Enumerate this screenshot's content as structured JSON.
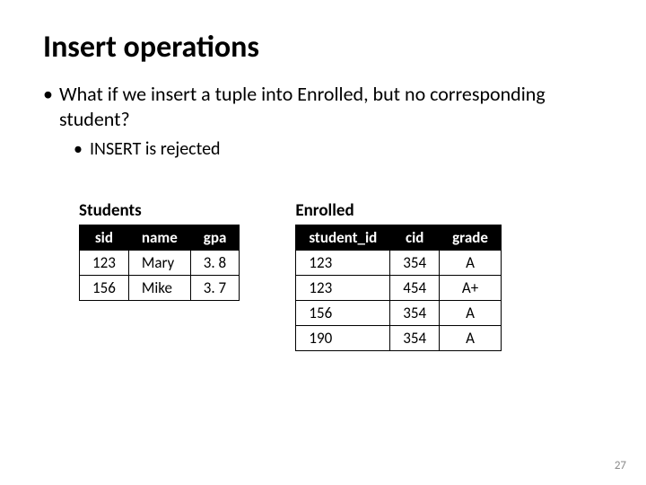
{
  "title": "Insert operations",
  "bullets": {
    "l1": "What if we insert a tuple into Enrolled, but no corresponding student?",
    "l2": "INSERT is rejected"
  },
  "students": {
    "caption": "Students",
    "headers": [
      "sid",
      "name",
      "gpa"
    ],
    "rows": [
      [
        "123",
        "Mary",
        "3. 8"
      ],
      [
        "156",
        "Mike",
        "3. 7"
      ]
    ]
  },
  "enrolled": {
    "caption": "Enrolled",
    "headers": [
      "student_id",
      "cid",
      "grade"
    ],
    "rows": [
      [
        "123",
        "354",
        "A"
      ],
      [
        "123",
        "454",
        "A+"
      ],
      [
        "156",
        "354",
        "A"
      ],
      [
        "190",
        "354",
        "A"
      ]
    ]
  },
  "page_number": "27",
  "chart_data": [
    {
      "type": "table",
      "title": "Students",
      "columns": [
        "sid",
        "name",
        "gpa"
      ],
      "rows": [
        [
          123,
          "Mary",
          3.8
        ],
        [
          156,
          "Mike",
          3.7
        ]
      ]
    },
    {
      "type": "table",
      "title": "Enrolled",
      "columns": [
        "student_id",
        "cid",
        "grade"
      ],
      "rows": [
        [
          123,
          354,
          "A"
        ],
        [
          123,
          454,
          "A+"
        ],
        [
          156,
          354,
          "A"
        ],
        [
          190,
          354,
          "A"
        ]
      ]
    }
  ]
}
